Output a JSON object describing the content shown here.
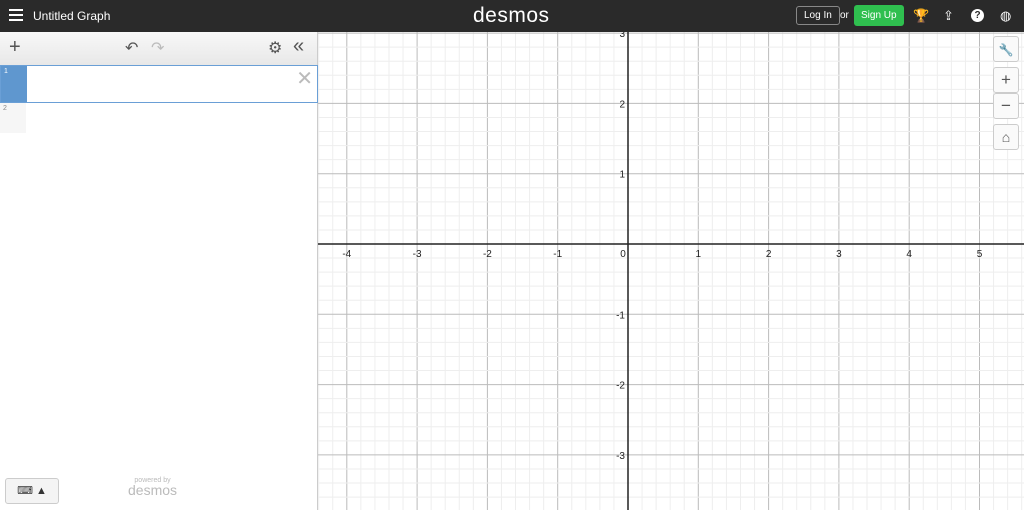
{
  "header": {
    "title": "Untitled Graph",
    "logo": "desmos",
    "login": "Log In",
    "or": "or",
    "signup": "Sign Up",
    "icons": [
      "trophy-icon",
      "share-icon",
      "help-icon",
      "language-icon"
    ]
  },
  "toolbar": {
    "add": "+",
    "undo": "↶",
    "redo": "↷",
    "settings": "⚙",
    "collapse": "«"
  },
  "expressions": [
    {
      "index": "1",
      "value": ""
    },
    {
      "index": "2",
      "value": ""
    }
  ],
  "footer": {
    "keyboard": "⌨ ▲",
    "powered_by": "powered by",
    "brand": "desmos"
  },
  "graph_controls": {
    "wrench": "🔧",
    "zoom_in": "+",
    "zoom_out": "−",
    "home": "⌂"
  },
  "axes": {
    "x_ticks": [
      "-4",
      "-3",
      "-2",
      "-1",
      "0",
      "1",
      "2",
      "3",
      "4",
      "5"
    ],
    "y_ticks": [
      "3",
      "2",
      "1",
      "-1",
      "-2",
      "-3"
    ]
  }
}
